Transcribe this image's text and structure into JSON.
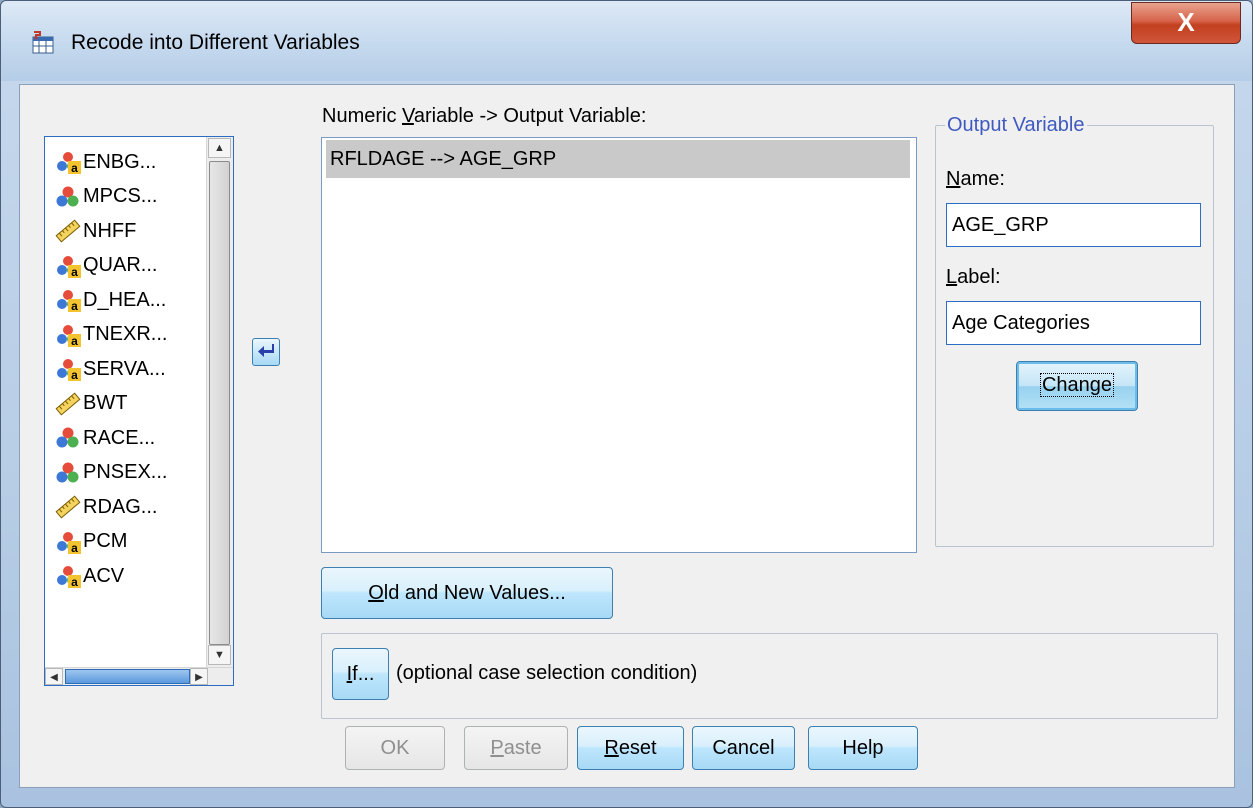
{
  "window": {
    "title": "Recode into Different Variables",
    "close_label": "X"
  },
  "variables": [
    {
      "label": "ENBG...",
      "icon": "nominal-string-icon"
    },
    {
      "label": "MPCS...",
      "icon": "nominal-icon"
    },
    {
      "label": "NHFF",
      "icon": "scale-ruler-icon"
    },
    {
      "label": "QUAR...",
      "icon": "nominal-string-icon"
    },
    {
      "label": "D_HEA...",
      "icon": "nominal-string-icon"
    },
    {
      "label": "TNEXR...",
      "icon": "nominal-string-icon"
    },
    {
      "label": "SERVA...",
      "icon": "nominal-string-icon"
    },
    {
      "label": "BWT",
      "icon": "scale-ruler-icon"
    },
    {
      "label": "RACE...",
      "icon": "nominal-icon"
    },
    {
      "label": "PNSEX...",
      "icon": "nominal-icon"
    },
    {
      "label": "RDAG...",
      "icon": "scale-ruler-icon"
    },
    {
      "label": "PCM",
      "icon": "nominal-string-icon"
    },
    {
      "label": "ACV",
      "icon": "nominal-string-icon"
    }
  ],
  "mapping": {
    "label": "Numeric Variable -> Output Variable:",
    "label_pre": "Numeric ",
    "label_mnemonic": "V",
    "label_post": "ariable -> Output Variable:",
    "row": "RFLDAGE --> AGE_GRP"
  },
  "output": {
    "legend": "Output Variable",
    "name_label_mnemonic": "N",
    "name_label_rest": "ame:",
    "name_value": "AGE_GRP",
    "label_label_mnemonic": "L",
    "label_label_rest": "abel:",
    "label_value": "Age Categories",
    "change_label": "Change"
  },
  "buttons": {
    "old_new_mnemonic": "O",
    "old_new_rest": "ld and New Values...",
    "if_mnemonic": "I",
    "if_rest": "f...",
    "if_text": "(optional case selection condition)",
    "ok": "OK",
    "paste_mnemonic": "P",
    "paste_rest": "aste",
    "reset_mnemonic": "R",
    "reset_rest": "eset",
    "cancel": "Cancel",
    "help": "Help"
  },
  "colors": {
    "accent": "#3c7fb1",
    "selection": "#c9c9c9",
    "legend_text": "#3f5abf"
  }
}
